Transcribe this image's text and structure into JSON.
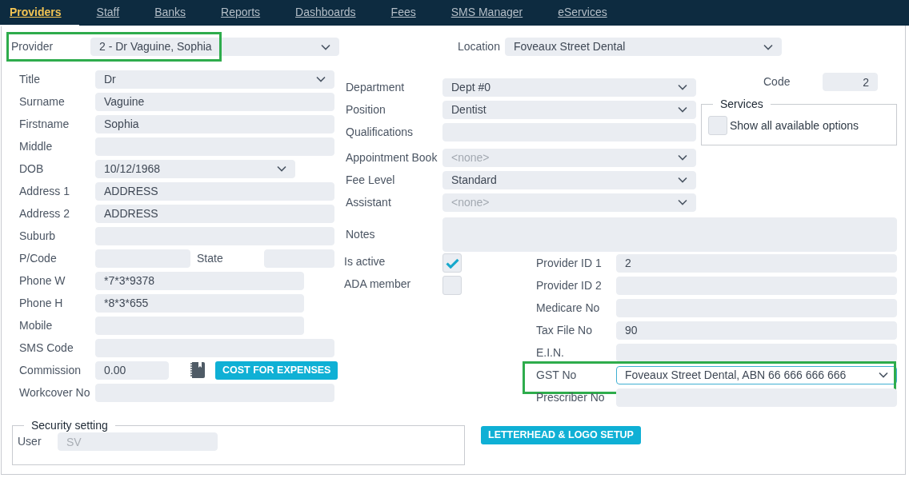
{
  "tabs": [
    {
      "label": "Providers",
      "selected": true
    },
    {
      "label": "Staff",
      "selected": false
    },
    {
      "label": "Banks",
      "selected": false
    },
    {
      "label": "Reports",
      "selected": false
    },
    {
      "label": "Dashboards",
      "selected": false
    },
    {
      "label": "Fees",
      "selected": false
    },
    {
      "label": "SMS Manager",
      "selected": false
    },
    {
      "label": "eServices",
      "selected": false
    }
  ],
  "provider": {
    "label": "Provider",
    "value": "2 - Dr Vaguine, Sophia",
    "highlighted": true
  },
  "location": {
    "label": "Location",
    "value": "Foveaux Street Dental"
  },
  "personal_fields": [
    {
      "label": "Title",
      "value": "Dr",
      "kind": "select"
    },
    {
      "label": "Surname",
      "value": "Vaguine",
      "kind": "text"
    },
    {
      "label": "Firstname",
      "value": "Sophia",
      "kind": "text"
    },
    {
      "label": "Middle",
      "kind": "text"
    },
    {
      "label": "DOB",
      "value": "10/12/1968",
      "kind": "date"
    },
    {
      "label": "Address 1",
      "value": "ADDRESS",
      "kind": "text"
    },
    {
      "label": "Address 2",
      "value": "ADDRESS",
      "kind": "text"
    },
    {
      "label": "Suburb",
      "kind": "text"
    },
    {
      "label": "P/Code",
      "kind": "pair",
      "second": {
        "label": "State"
      }
    },
    {
      "label": "Phone W",
      "value": "*7*3*9378",
      "kind": "phone"
    },
    {
      "label": "Phone H",
      "value": "*8*3*655",
      "kind": "phone"
    },
    {
      "label": "Mobile",
      "kind": "phone"
    },
    {
      "label": "SMS Code",
      "kind": "text"
    },
    {
      "label": "Commission",
      "value": "0.00",
      "kind": "commission",
      "button": "COST FOR EXPENSES"
    },
    {
      "label": "Workcover No",
      "kind": "text"
    }
  ],
  "job_fields": [
    {
      "label": "Department",
      "value": "Dept #0",
      "kind": "select"
    },
    {
      "label": "Position",
      "value": "Dentist",
      "kind": "select"
    },
    {
      "label": "Qualifications",
      "kind": "text"
    },
    {
      "label": "Appointment Book",
      "placeholder": "<none>",
      "kind": "select"
    },
    {
      "label": "Fee Level",
      "value": "Standard",
      "kind": "select"
    },
    {
      "label": "Assistant",
      "placeholder": "<none>",
      "kind": "select"
    }
  ],
  "code": {
    "label": "Code",
    "value": "2"
  },
  "services": {
    "title": "Services",
    "options": [
      {
        "label": "Show all available options",
        "checked": false
      }
    ]
  },
  "notes": {
    "label": "Notes"
  },
  "flags": [
    {
      "label": "Is active",
      "checked": true
    },
    {
      "label": "ADA member",
      "checked": false
    }
  ],
  "id_fields": [
    {
      "label": "Provider ID 1",
      "value": "2",
      "kind": "text"
    },
    {
      "label": "Provider ID 2",
      "kind": "text"
    },
    {
      "label": "Medicare No",
      "kind": "text"
    },
    {
      "label": "Tax File No",
      "value": "90",
      "kind": "text"
    },
    {
      "label": "E.I.N.",
      "kind": "text"
    },
    {
      "label": "GST No",
      "value": "Foveaux Street Dental, ABN 66 666 666 666",
      "kind": "select",
      "focused": true,
      "highlighted": true
    },
    {
      "label": "Prescriber No",
      "kind": "text"
    }
  ],
  "security": {
    "title": "Security setting",
    "user": {
      "label": "User",
      "value": "SV",
      "disabled": true
    }
  },
  "letterhead_button": "LETTERHEAD & LOGO SETUP"
}
